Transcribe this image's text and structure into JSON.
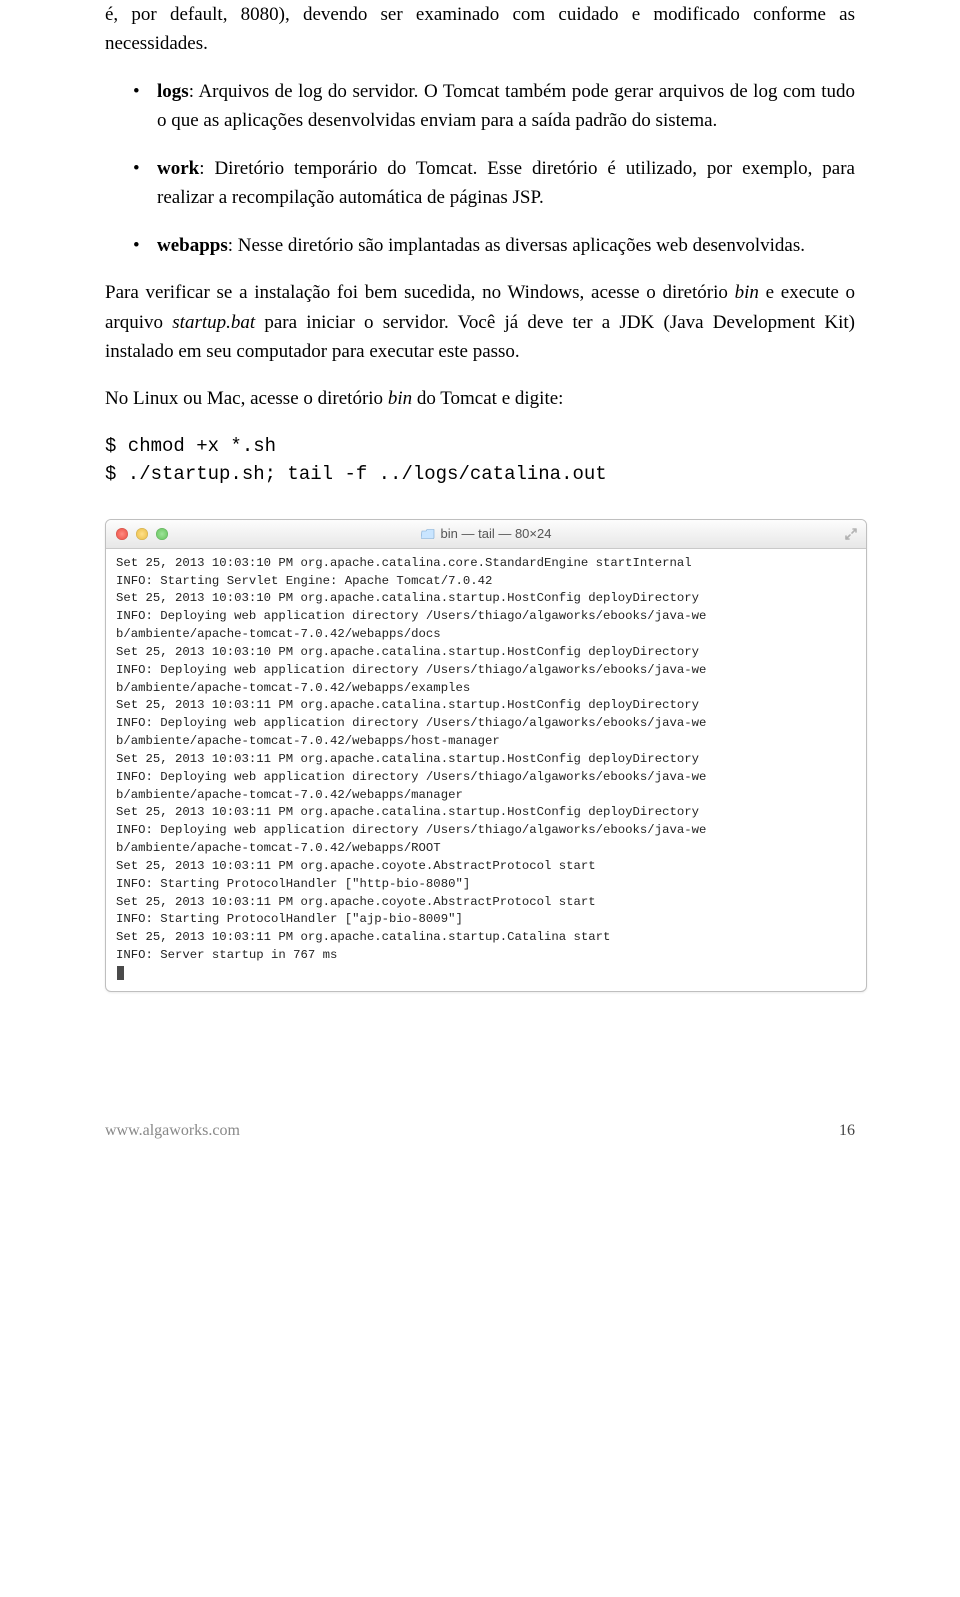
{
  "para_intro": "é, por default, 8080), devendo ser examinado com cuidado e modificado conforme as necessidades.",
  "bullets": {
    "logs": {
      "label": "logs",
      "text": ": Arquivos de log do servidor. O Tomcat também pode gerar arquivos de log com tudo o que as aplicações desenvolvidas enviam para a saída padrão do sistema."
    },
    "work": {
      "label": "work",
      "text": ": Diretório temporário do Tomcat. Esse diretório é utilizado, por exemplo, para realizar a recompilação automática de páginas JSP."
    },
    "webapps": {
      "label": "webapps",
      "text": ": Nesse diretório são implantadas as diversas aplicações web desenvolvidas."
    }
  },
  "para_verify_1": "Para verificar se a instalação foi bem sucedida, no Windows, acesse o diretório ",
  "para_verify_bin": "bin",
  "para_verify_2": " e execute o arquivo ",
  "para_verify_startup": "startup.bat",
  "para_verify_3": " para iniciar o servidor. Você já deve ter a JDK (Java Development Kit) instalado em seu computador para executar este passo.",
  "para_linux_1": "No Linux ou Mac, acesse o diretório ",
  "para_linux_bin": "bin",
  "para_linux_2": " do Tomcat e digite:",
  "code": "$ chmod +x *.sh\n$ ./startup.sh; tail -f ../logs/catalina.out",
  "terminal": {
    "title": "bin — tail — 80×24",
    "lines": [
      "Set 25, 2013 10:03:10 PM org.apache.catalina.core.StandardEngine startInternal",
      "INFO: Starting Servlet Engine: Apache Tomcat/7.0.42",
      "Set 25, 2013 10:03:10 PM org.apache.catalina.startup.HostConfig deployDirectory",
      "INFO: Deploying web application directory /Users/thiago/algaworks/ebooks/java-we",
      "b/ambiente/apache-tomcat-7.0.42/webapps/docs",
      "Set 25, 2013 10:03:10 PM org.apache.catalina.startup.HostConfig deployDirectory",
      "INFO: Deploying web application directory /Users/thiago/algaworks/ebooks/java-we",
      "b/ambiente/apache-tomcat-7.0.42/webapps/examples",
      "Set 25, 2013 10:03:11 PM org.apache.catalina.startup.HostConfig deployDirectory",
      "INFO: Deploying web application directory /Users/thiago/algaworks/ebooks/java-we",
      "b/ambiente/apache-tomcat-7.0.42/webapps/host-manager",
      "Set 25, 2013 10:03:11 PM org.apache.catalina.startup.HostConfig deployDirectory",
      "INFO: Deploying web application directory /Users/thiago/algaworks/ebooks/java-we",
      "b/ambiente/apache-tomcat-7.0.42/webapps/manager",
      "Set 25, 2013 10:03:11 PM org.apache.catalina.startup.HostConfig deployDirectory",
      "INFO: Deploying web application directory /Users/thiago/algaworks/ebooks/java-we",
      "b/ambiente/apache-tomcat-7.0.42/webapps/ROOT",
      "Set 25, 2013 10:03:11 PM org.apache.coyote.AbstractProtocol start",
      "INFO: Starting ProtocolHandler [\"http-bio-8080\"]",
      "Set 25, 2013 10:03:11 PM org.apache.coyote.AbstractProtocol start",
      "INFO: Starting ProtocolHandler [\"ajp-bio-8009\"]",
      "Set 25, 2013 10:03:11 PM org.apache.catalina.startup.Catalina start",
      "INFO: Server startup in 767 ms"
    ]
  },
  "footer": {
    "site": "www.algaworks.com",
    "page": "16"
  }
}
